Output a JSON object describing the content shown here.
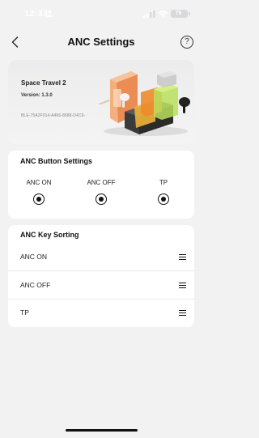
{
  "status_bar": {
    "time": "12:33",
    "battery": "76"
  },
  "header": {
    "title": "ANC Settings",
    "help_label": "?"
  },
  "device": {
    "name": "Space Travel 2",
    "version": "Version: 1.3.0",
    "id": "BLE-75A2F014-A466-8688-D4C6-"
  },
  "anc_button_settings": {
    "title": "ANC Button Settings",
    "options": [
      {
        "label": "ANC ON",
        "selected": true
      },
      {
        "label": "ANC OFF",
        "selected": true
      },
      {
        "label": "TP",
        "selected": true
      }
    ]
  },
  "anc_key_sorting": {
    "title": "ANC Key Sorting",
    "items": [
      {
        "label": "ANC ON"
      },
      {
        "label": "ANC OFF"
      },
      {
        "label": "TP"
      }
    ]
  },
  "colors": {
    "background": "#f2f2f3",
    "card": "#ffffff",
    "text": "#111111"
  }
}
